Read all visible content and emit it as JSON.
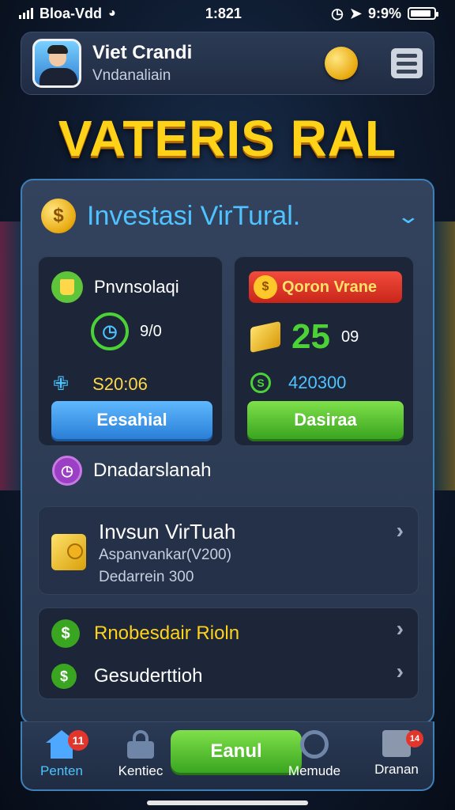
{
  "status": {
    "carrier": "Bloa-Vdd",
    "time": "1:821",
    "battery": "9:9%",
    "battery_level": 0.9
  },
  "profile": {
    "name": "Viet Crandi",
    "subtitle": "Vndanaliain"
  },
  "app_title": "VATERIS RAL",
  "panel": {
    "title": "Investasi VirTural.",
    "coin_symbol": "$",
    "left_card": {
      "title": "Pnvnsolaqi",
      "timer_value": "9/0",
      "price": "S20:06",
      "button_label": "Eesahial"
    },
    "right_card": {
      "badge_label": "Qoron Vrane",
      "big_number": "25",
      "small_number": "09",
      "value": "420300",
      "button_label": "Dasiraa"
    },
    "history_label": "Dnadarslanah",
    "list_item": {
      "title": "Invsun VirTuah",
      "line1": "Aspanvankar(V200)",
      "line2": "Dedarrein 300"
    },
    "options": [
      {
        "label": "Rnobesdair Rioln"
      },
      {
        "label": "Gesuderttioh"
      }
    ]
  },
  "nav": {
    "items": [
      {
        "label": "Penten",
        "badge": "11"
      },
      {
        "label": "Kentiec"
      },
      {
        "label": "Eanul"
      },
      {
        "label": "Memude"
      },
      {
        "label": "Dranan",
        "badge": "14"
      }
    ]
  },
  "colors": {
    "accent_blue": "#4fc3ff",
    "title_gold": "#ffd21a",
    "button_blue": "#2a7fd6",
    "button_green": "#3aa520",
    "badge_red": "#e2362c"
  }
}
